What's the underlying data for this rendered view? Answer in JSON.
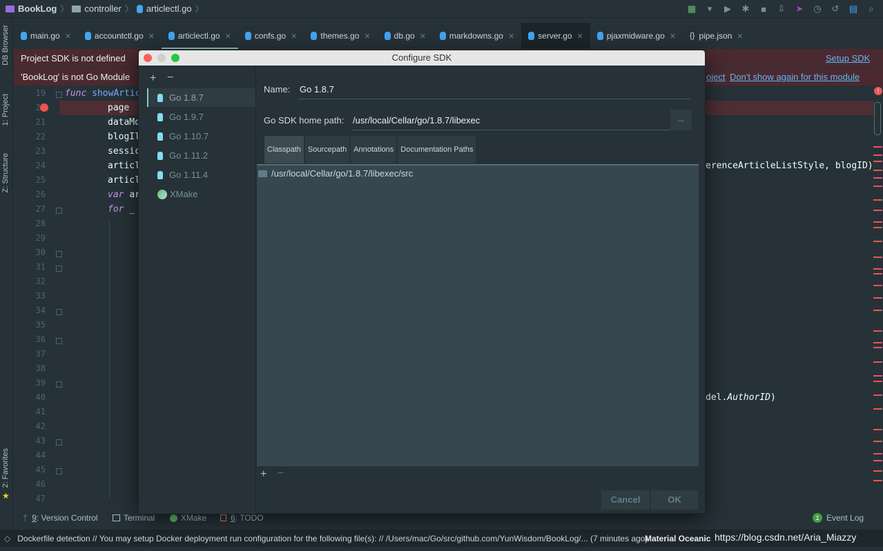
{
  "breadcrumb": [
    "BookLog",
    "controller",
    "articlectl.go"
  ],
  "left_tools": {
    "db_browser": "DB Browser",
    "project": "1: Project",
    "structure": "Z: Structure",
    "favorites": "2: Favorites"
  },
  "tabs": [
    {
      "label": "main.go"
    },
    {
      "label": "accountctl.go"
    },
    {
      "label": "articlectl.go",
      "active": true
    },
    {
      "label": "confs.go"
    },
    {
      "label": "themes.go"
    },
    {
      "label": "db.go"
    },
    {
      "label": "markdowns.go"
    },
    {
      "label": "server.go"
    },
    {
      "label": "pjaxmidware.go"
    },
    {
      "label": "pipe.json"
    }
  ],
  "notifications": {
    "sdk": {
      "text": "Project SDK is not defined",
      "link": "Setup SDK"
    },
    "module": {
      "text": "'BookLog' is not Go Module",
      "link1": "oject",
      "link2": "Don't show again for this module"
    }
  },
  "editor": {
    "line_numbers": [
      "19",
      "20",
      "21",
      "22",
      "23",
      "24",
      "25",
      "26",
      "27",
      "28",
      "29",
      "30",
      "31",
      "32",
      "33",
      "34",
      "35",
      "36",
      "37",
      "38",
      "39",
      "40",
      "41",
      "42",
      "43",
      "44",
      "45",
      "46",
      "47"
    ],
    "lines": {
      "l19_kw": "func",
      "l19_fn": "showArtic",
      "l20": "page",
      "l21": "dataMo",
      "l22": "blogIl",
      "l23": "sessic",
      "l24": "articl",
      "l24_right": "erenceArticleListStyle, blogID)",
      "l25": "articl",
      "l26_kw": "var",
      "l26": "ar",
      "l27_kw": "for",
      "l27": "_",
      "l40_right_a": "del.",
      "l40_right_b": "AuthorID",
      "l40_right_c": ")"
    }
  },
  "dialog": {
    "title": "Configure SDK",
    "sdks": [
      "Go 1.8.7",
      "Go 1.9.7",
      "Go 1.10.7",
      "Go 1.11.2",
      "Go 1.11.4",
      "XMake"
    ],
    "name_label": "Name:",
    "name_value": "Go 1.8.7",
    "home_label": "Go SDK home path:",
    "home_value": "/usr/local/Cellar/go/1.8.7/libexec",
    "browse": "...",
    "tabs": [
      "Classpath",
      "Sourcepath",
      "Annotations",
      "Documentation Paths"
    ],
    "classpath": [
      "/usr/local/Cellar/go/1.8.7/libexec/src"
    ],
    "cancel": "Cancel",
    "ok": "OK"
  },
  "tool_windows": {
    "vcs_num": "9",
    "vcs": ": Version Control",
    "terminal": "Terminal",
    "xmake": "XMake",
    "todo_num": "6",
    "todo": ": TODO",
    "event_log_count": "1",
    "event_log": "Event Log"
  },
  "status": {
    "message": "Dockerfile detection  // You may setup Docker deployment run configuration for the following file(s): // /Users/mac/Go/src/github.com/YunWisdom/BookLog/... (7 minutes ago)",
    "theme": "Material Oceanic",
    "watermark": "https://blog.csdn.net/Aria_Miazzy"
  },
  "colors": {
    "background": "#263238",
    "accent": "#80cbc4",
    "error_bar": "#4a2a30",
    "link": "#64b5f6",
    "breakpoint": "#ef5350"
  }
}
